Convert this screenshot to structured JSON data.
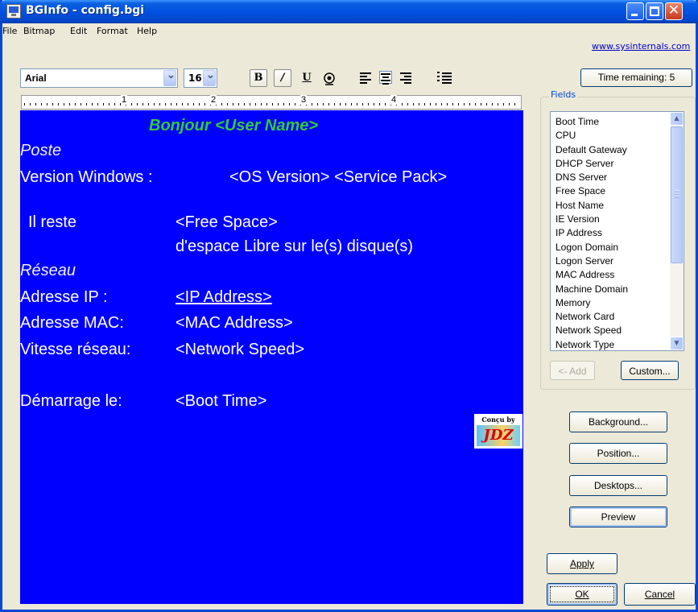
{
  "window": {
    "title": "BGInfo - config.bgi"
  },
  "menu": {
    "items": [
      "File",
      "Bitmap",
      "Edit",
      "Format",
      "Help"
    ]
  },
  "header_link": "www.sysinternals.com",
  "toolbar": {
    "font_name": "Arial",
    "font_size": "16",
    "bold_label": "B",
    "italic_label": "/",
    "underline_label": "U",
    "time_remaining": "Time remaining: 5"
  },
  "ruler": {
    "marks": [
      "1",
      "2",
      "3",
      "4"
    ]
  },
  "editor": {
    "greeting": "Bonjour  <User Name>",
    "section_poste": "Poste",
    "os_label": "Version Windows :",
    "os_value": "<OS Version> <Service Pack>",
    "free_label": "Il reste",
    "free_value": "<Free Space>",
    "free_suffix": "d'espace Libre sur le(s) disque(s)",
    "section_reseau": "Réseau",
    "ip_label": "Adresse IP :",
    "ip_value": "<IP Address>",
    "mac_label": "Adresse MAC:",
    "mac_value": "<MAC Address>",
    "speed_label": "Vitesse réseau:",
    "speed_value": "<Network Speed>",
    "boot_label": "Démarrage le:",
    "boot_value": "<Boot Time>",
    "logo_top": "Conçu by",
    "logo_text": "JDZ"
  },
  "fields": {
    "legend": "Fields",
    "items": [
      "Boot Time",
      "CPU",
      "Default Gateway",
      "DHCP Server",
      "DNS Server",
      "Free Space",
      "Host Name",
      "IE Version",
      "IP Address",
      "Logon Domain",
      "Logon Server",
      "MAC Address",
      "Machine Domain",
      "Memory",
      "Network Card",
      "Network Speed",
      "Network Type"
    ],
    "add_label": "<- Add",
    "custom_label": "Custom..."
  },
  "buttons": {
    "background": "Background...",
    "position": "Position...",
    "desktops": "Desktops...",
    "preview": "Preview",
    "apply": "Apply",
    "ok": "OK",
    "cancel": "Cancel"
  }
}
